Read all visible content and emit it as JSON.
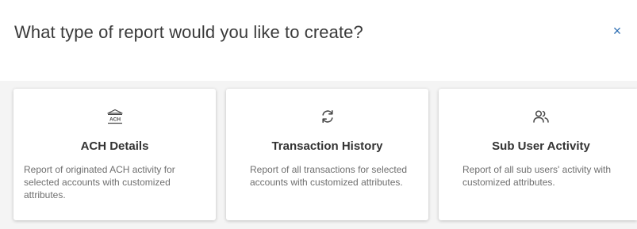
{
  "dialog": {
    "title": "What type of report would you like to create?",
    "close_glyph": "×",
    "accent_color": "#2f6fb3"
  },
  "cards": [
    {
      "icon": "bank-ach-icon",
      "icon_text": "ACH",
      "title": "ACH Details",
      "description": "Report of originated ACH activity for selected accounts with customized attributes."
    },
    {
      "icon": "sync-arrows-icon",
      "title": "Transaction History",
      "description": "Report of all transactions for selected accounts with customized attributes."
    },
    {
      "icon": "users-icon",
      "title": "Sub User Activity",
      "description": "Report of all sub users' activity with customized attributes."
    }
  ]
}
